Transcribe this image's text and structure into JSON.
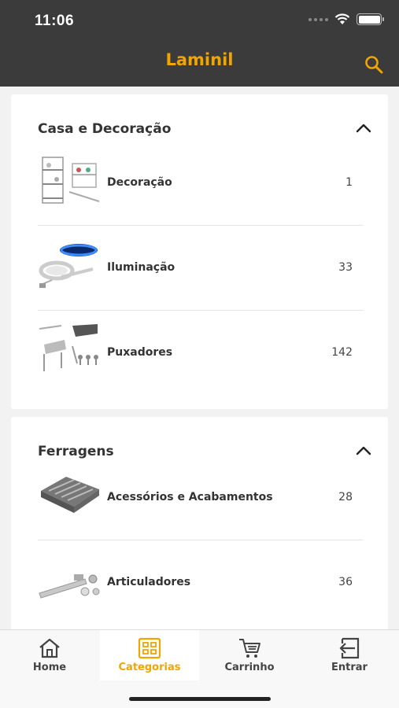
{
  "status_bar": {
    "time": "11:06"
  },
  "header": {
    "logo_text": "Laminil",
    "search_icon": "search-icon"
  },
  "sections": [
    {
      "title": "Casa e Decoração",
      "expanded": true,
      "items": [
        {
          "label": "Decoração",
          "count": "1",
          "thumb": "shelf-rack-image"
        },
        {
          "label": "Iluminação",
          "count": "33",
          "thumb": "led-strip-image"
        },
        {
          "label": "Puxadores",
          "count": "142",
          "thumb": "handles-image"
        }
      ]
    },
    {
      "title": "Ferragens",
      "expanded": true,
      "items": [
        {
          "label": "Acessórios e Acabamentos",
          "count": "28",
          "thumb": "cutlery-tray-image"
        },
        {
          "label": "Articuladores",
          "count": "36",
          "thumb": "hinge-stay-image"
        }
      ]
    }
  ],
  "tabbar": {
    "tabs": [
      {
        "label": "Home",
        "icon": "home-icon",
        "active": false
      },
      {
        "label": "Categorias",
        "icon": "grid-icon",
        "active": true
      },
      {
        "label": "Carrinho",
        "icon": "cart-icon",
        "active": false
      },
      {
        "label": "Entrar",
        "icon": "login-icon",
        "active": false
      }
    ]
  },
  "colors": {
    "accent": "#f2a400",
    "header_bg": "#3b3b3b"
  }
}
